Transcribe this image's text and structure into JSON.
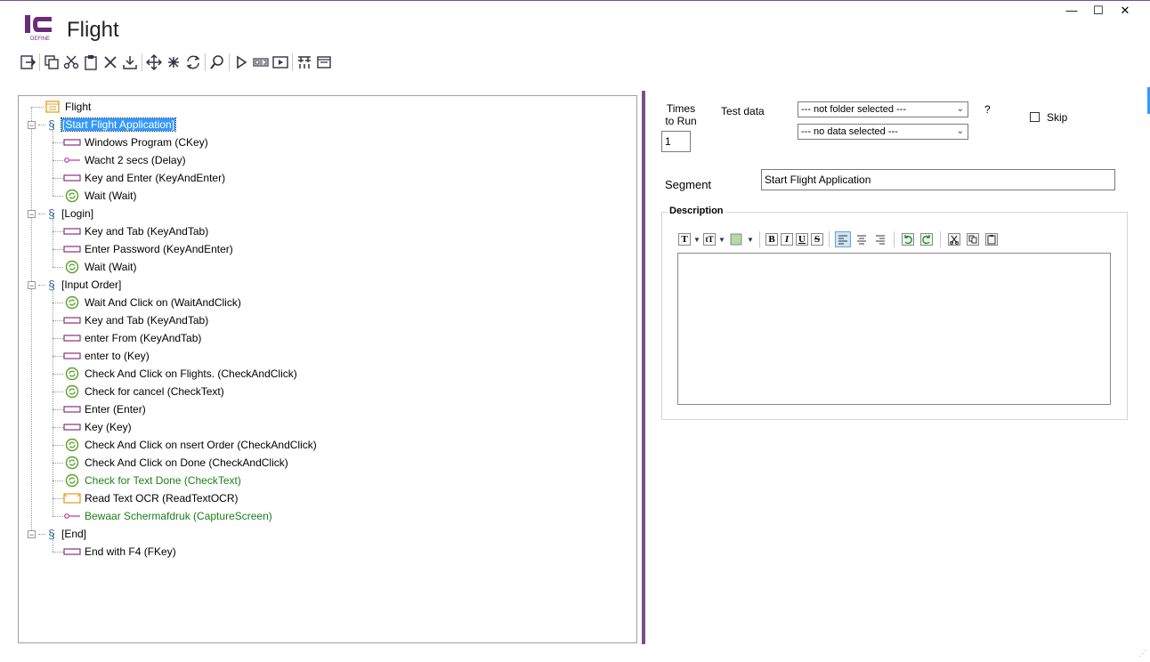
{
  "window": {
    "title": "Flight",
    "logo_text": "DEFINE",
    "controls": {
      "minimize": "—",
      "maximize": "☐",
      "close": "✕"
    }
  },
  "toolbar": {
    "icons": [
      "exit-icon",
      "copy-icon",
      "cut-icon",
      "paste-icon",
      "delete-icon",
      "import-icon",
      "move-icon",
      "expand-icon",
      "refresh-icon",
      "find-icon",
      "run-icon",
      "record-icon",
      "play-video-icon",
      "filter-icon",
      "window-icon"
    ]
  },
  "tree": {
    "root": "Flight",
    "items": [
      {
        "level": 1,
        "type": "section",
        "label": "[Start Flight Application]",
        "selected": true
      },
      {
        "level": 2,
        "type": "key",
        "label": "Windows Program (CKey)"
      },
      {
        "level": 2,
        "type": "delay",
        "label": "Wacht 2 secs (Delay)"
      },
      {
        "level": 2,
        "type": "key",
        "label": "Key and Enter (KeyAndEnter)"
      },
      {
        "level": 2,
        "type": "wait",
        "label": "Wait  (Wait)"
      },
      {
        "level": 1,
        "type": "section",
        "label": "[Login]"
      },
      {
        "level": 2,
        "type": "key",
        "label": "Key and Tab (KeyAndTab)"
      },
      {
        "level": 2,
        "type": "key",
        "label": "Enter Password (KeyAndEnter)"
      },
      {
        "level": 2,
        "type": "wait",
        "label": "Wait  (Wait)"
      },
      {
        "level": 1,
        "type": "section",
        "label": "[Input Order]"
      },
      {
        "level": 2,
        "type": "wait",
        "label": "Wait And Click on  (WaitAndClick)"
      },
      {
        "level": 2,
        "type": "key",
        "label": "Key and Tab (KeyAndTab)"
      },
      {
        "level": 2,
        "type": "key",
        "label": "enter From (KeyAndTab)"
      },
      {
        "level": 2,
        "type": "key",
        "label": "enter to (Key)"
      },
      {
        "level": 2,
        "type": "wait",
        "label": "Check And Click on Flights. (CheckAndClick)"
      },
      {
        "level": 2,
        "type": "wait",
        "label": "Check for cancel (CheckText)"
      },
      {
        "level": 2,
        "type": "key",
        "label": "Enter (Enter)"
      },
      {
        "level": 2,
        "type": "key",
        "label": "Key (Key)"
      },
      {
        "level": 2,
        "type": "wait",
        "label": "Check And Click on nsert Order (CheckAndClick)"
      },
      {
        "level": 2,
        "type": "wait",
        "label": "Check And Click on Done (CheckAndClick)"
      },
      {
        "level": 2,
        "type": "wait",
        "label": "Check for Text Done (CheckText)",
        "green": true
      },
      {
        "level": 2,
        "type": "ocr",
        "label": "Read Text OCR (ReadTextOCR)"
      },
      {
        "level": 2,
        "type": "delay",
        "label": "Bewaar Schermafdruk (CaptureScreen)",
        "green": true
      },
      {
        "level": 1,
        "type": "section",
        "label": "[End]"
      },
      {
        "level": 2,
        "type": "key",
        "label": "End with F4 (FKey)"
      }
    ]
  },
  "panel": {
    "times_to_run_label": "Times\nto Run",
    "times_to_run_value": "1",
    "test_data_label": "Test data",
    "folder_select": "--- not folder selected ---",
    "data_select": "--- no data selected ---",
    "help": "?",
    "skip_label": "Skip",
    "skip_checked": false,
    "segment_label": "Segment",
    "segment_value": "Start Flight Application",
    "description_label": "Description",
    "description_value": ""
  },
  "colors": {
    "accent": "#7a4f8c",
    "selection": "#3399ff",
    "green_text": "#1a7f1a",
    "section_icon": "#3b6ea5",
    "key_icon": "#8b2f7a",
    "wait_icon": "#5aa02c",
    "ocr_icon": "#e0a020"
  }
}
